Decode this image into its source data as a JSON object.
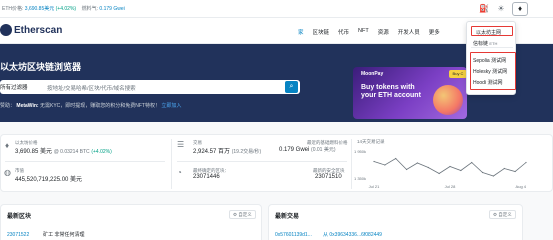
{
  "ticker": {
    "price_label": "ETH价格:",
    "price": "3,690.85美元",
    "change": "(+4.02%)",
    "gas_label": "燃料气:",
    "gas": "0.179 Gwei"
  },
  "header": {
    "logo": "Etherscan",
    "nav": [
      "家",
      "区块链",
      "代币",
      "NFT",
      "资源",
      "开发人员",
      "更多"
    ]
  },
  "network_menu": {
    "selected": "以太坊主网",
    "staking": "信标链",
    "staking_suffix": "ETH",
    "testnets": [
      "Sepolia 测试网",
      "Holesky 测试网",
      "Hoodi 测试网"
    ]
  },
  "hero": {
    "title": "以太坊区块链浏览器",
    "search_filter": "所有过滤器",
    "search_placeholder": "按地址/交易哈希/区块/代币/域名搜索",
    "sponsored_prefix": "赞助：",
    "sponsored_name": "MetaWin:",
    "sponsored_text": "无需KYC，即时提现，赚取您的积分和免费NFT特权！",
    "sponsored_link": "立即加入"
  },
  "ad": {
    "logo": "MoonPay",
    "chip": "Buy C",
    "line1": "Buy tokens with",
    "line2": "your ETH account"
  },
  "stats": {
    "price_label": "以太坊价格",
    "price_value": "3,690.85 美元",
    "price_btc": "@ 0.03214 BTC",
    "price_change": "(+4.02%)",
    "mcap_label": "市值",
    "mcap_value": "445,520,719,225.00 美元",
    "tx_label": "交易",
    "tx_value": "2,924.57 百万",
    "tx_tps": "(19.2交易/秒)",
    "gas_label": "最近的基础燃料价格",
    "gas_value": "0.179 Gwei",
    "gas_fee": "(0.01 美元)",
    "finalized_label": "最终确定的区块：",
    "finalized_value": "23071446",
    "safe_label": "最新的安全区块",
    "safe_value": "23071510"
  },
  "chart_data": {
    "type": "line",
    "title": "14天交易记录",
    "x": [
      "Jul 21",
      "Jul 22",
      "Jul 23",
      "Jul 24",
      "Jul 25",
      "Jul 26",
      "Jul 27",
      "Jul 28",
      "Jul 29",
      "Jul 30",
      "Jul 31",
      "Aug 1",
      "Aug 2",
      "Aug 3",
      "Aug 4"
    ],
    "xticks": [
      "Jul 21",
      "Jul 28",
      "Aug 4"
    ],
    "yticks": [
      "1 950k",
      "1 350k"
    ],
    "values": [
      1720,
      1650,
      1780,
      1560,
      1690,
      1600,
      1480,
      1620,
      1540,
      1700,
      1500,
      1430,
      1580,
      1520,
      1700
    ],
    "ylim": [
      1350,
      1950
    ]
  },
  "panels": {
    "blocks_title": "最新区块",
    "blocks_button": "自定义",
    "blocks_row_id": "23071522",
    "blocks_row_text": "矿工 非常任何清理",
    "tx_title": "最新交易",
    "tx_button": "自定义",
    "tx_row_hash": "0x57601139d1...",
    "tx_row_from": "从 0x39634336...6f082449"
  }
}
